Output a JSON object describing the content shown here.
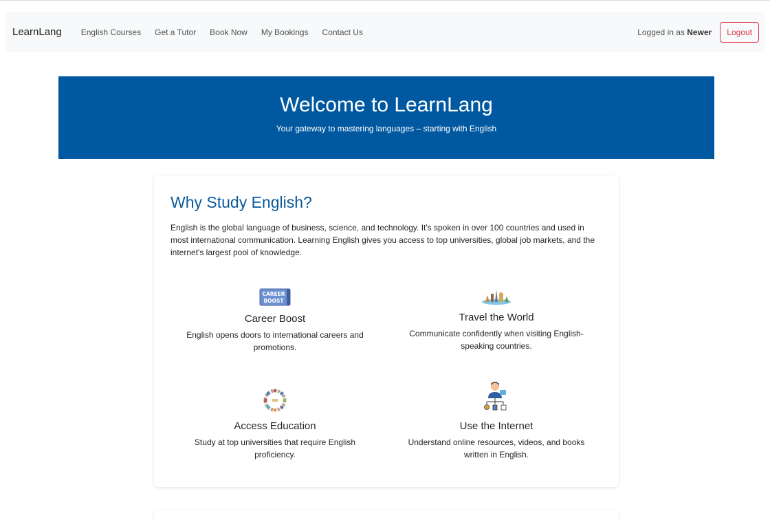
{
  "nav": {
    "brand": "LearnLang",
    "links": [
      "English Courses",
      "Get a Tutor",
      "Book Now",
      "My Bookings",
      "Contact Us"
    ],
    "logged_in_prefix": "Logged in as",
    "username": "Newer",
    "logout_label": "Logout"
  },
  "hero": {
    "title": "Welcome to LearnLang",
    "subtitle": "Your gateway to mastering languages – starting with English"
  },
  "why": {
    "title": "Why Study English?",
    "intro": "English is the global language of business, science, and technology. It's spoken in over 100 countries and used in most international communication. Learning English gives you access to top universities, global job markets, and the internet's largest pool of knowledge.",
    "features": [
      {
        "title": "Career Boost",
        "text": "English opens doors to international careers and promotions.",
        "icon": "career-boost-badge-icon",
        "badge_text": "CAREER BOOST"
      },
      {
        "title": "Travel the World",
        "text": "Communicate confidently when visiting English-speaking countries.",
        "icon": "world-landmarks-icon"
      },
      {
        "title": "Access Education",
        "text": "Study at top universities that require English proficiency.",
        "icon": "people-circle-icon"
      },
      {
        "title": "Use the Internet",
        "text": "Understand online resources, videos, and books written in English.",
        "icon": "person-network-icon"
      }
    ]
  },
  "colors": {
    "hero_bg": "#0058a0",
    "heading_blue": "#0a5a9c",
    "logout_red": "#dc3545",
    "navbar_bg": "#f8f9fa"
  }
}
